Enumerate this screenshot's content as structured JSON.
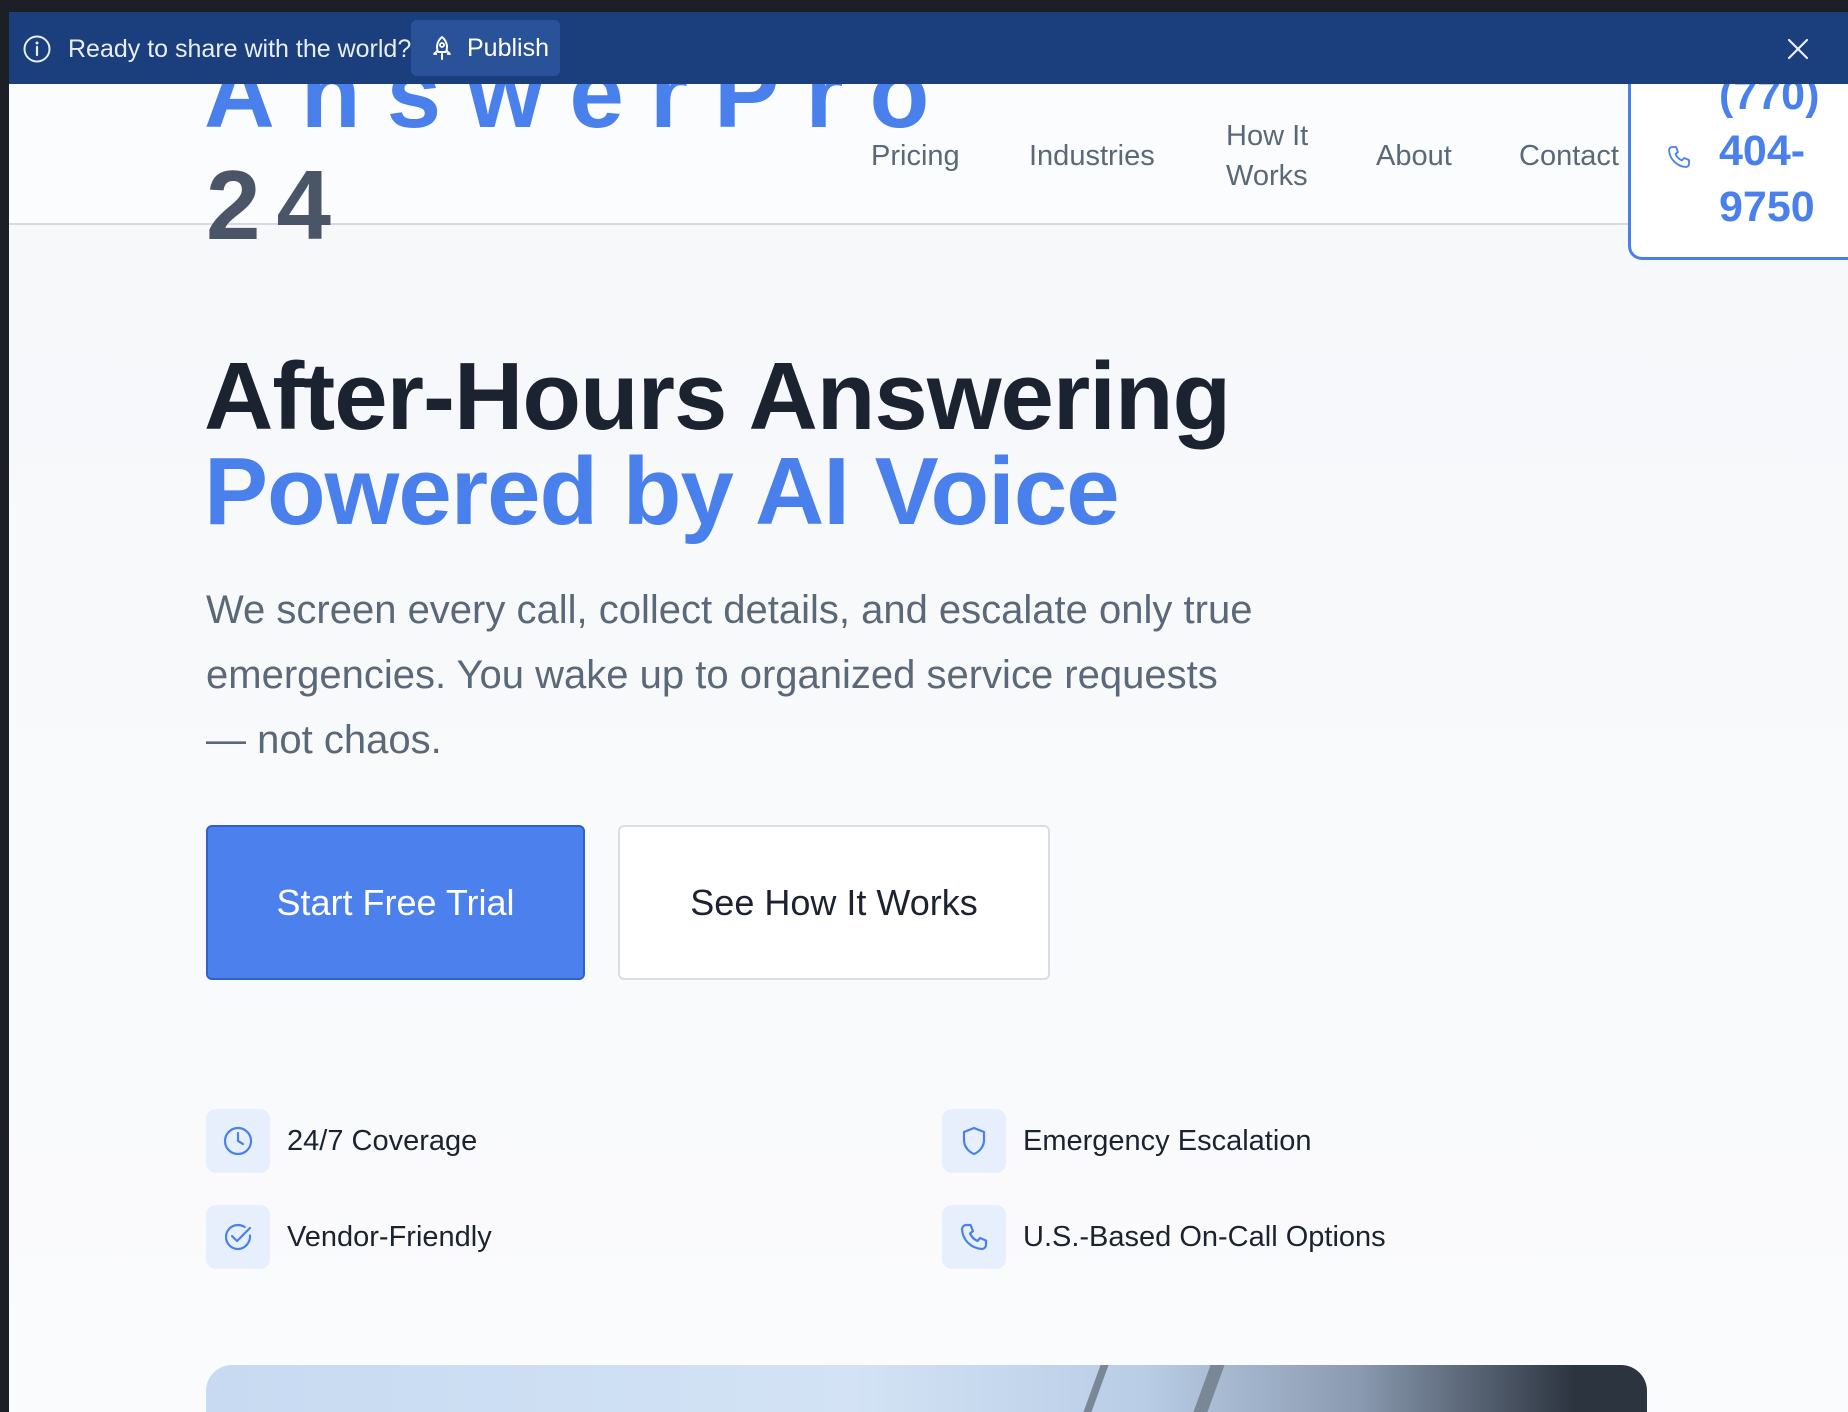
{
  "publish_bar": {
    "message": "Ready to share with the world?",
    "publish_label": "Publish"
  },
  "header": {
    "logo_line1": "AnswerPro",
    "logo_line2": "24",
    "nav": {
      "pricing": "Pricing",
      "industries": "Industries",
      "how_it_works": "How It Works",
      "about": "About",
      "contact": "Contact"
    },
    "phone": "(770) 404-9750"
  },
  "hero": {
    "title_line1": "After-Hours Answering",
    "title_line2": "Powered by AI Voice",
    "subtitle": "We screen every call, collect details, and escalate only true emergencies. You wake up to organized service requests — not chaos.",
    "primary_cta": "Start Free Trial",
    "secondary_cta": "See How It Works"
  },
  "features": [
    {
      "label": "24/7 Coverage",
      "icon": "clock-icon"
    },
    {
      "label": "Emergency Escalation",
      "icon": "shield-icon"
    },
    {
      "label": "Vendor-Friendly",
      "icon": "check-circle-icon"
    },
    {
      "label": "U.S.-Based On-Call Options",
      "icon": "phone-icon"
    }
  ],
  "colors": {
    "brand_blue": "#4a80eb",
    "banner_navy": "#1a3f7c",
    "heading_dark": "#1c2330",
    "body_gray": "#5b6878"
  }
}
